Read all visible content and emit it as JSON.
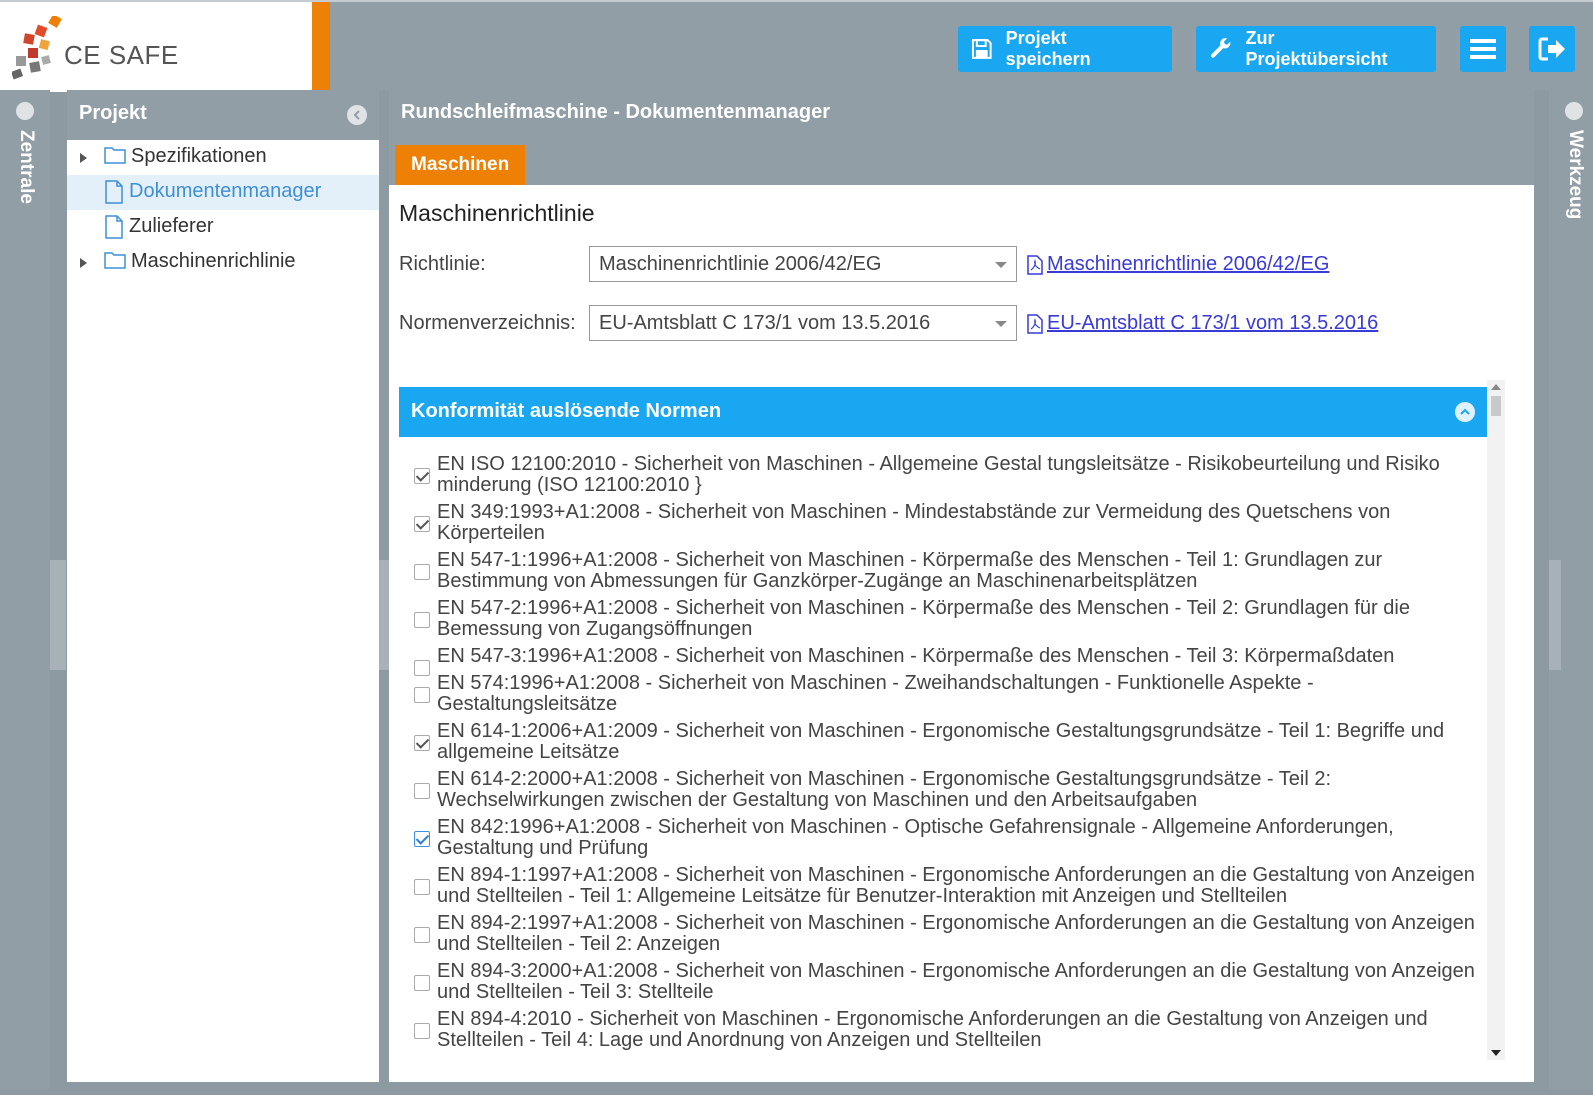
{
  "header": {
    "logo_text": "CE SAFE",
    "save_label": "Projekt speichern",
    "overview_label": "Zur Projektübersicht"
  },
  "rails": {
    "left_label": "Zentrale",
    "right_label": "Werkzeug"
  },
  "project_panel": {
    "title": "Projekt",
    "tree": [
      {
        "label": "Spezifikationen",
        "type": "folder",
        "expandable": true
      },
      {
        "label": "Dokumentenmanager",
        "type": "file",
        "selected": true
      },
      {
        "label": "Zulieferer",
        "type": "file"
      },
      {
        "label": "Maschinenrichlinie",
        "type": "folder",
        "expandable": true
      }
    ]
  },
  "main": {
    "title": "Rundschleifmaschine - Dokumentenmanager",
    "tab": "Maschinen",
    "section_title": "Maschinenrichtlinie",
    "richtlinie_label": "Richtlinie:",
    "richtlinie_value": "Maschinenrichtlinie 2006/42/EG",
    "richtlinie_link": "Maschinenrichtlinie 2006/42/EG",
    "normen_label": "Normenverzeichnis:",
    "normen_value": "EU-Amtsblatt C 173/1 vom 13.5.2016",
    "normen_link": "EU-Amtsblatt C 173/1 vom 13.5.2016",
    "accordion_title": "Konformität auslösende Normen"
  },
  "norms": [
    {
      "text": "EN ISO 12100:2010 - Sicherheit von Maschinen - Allgemeine Gestal tungsleitsätze - Risikobeurteilung und Risiko minderung (ISO 12100:2010 }",
      "checked": true
    },
    {
      "text": "EN 349:1993+A1:2008 - Sicherheit von Maschinen - Mindestabstände zur Vermeidung des Quetschens von Körperteilen",
      "checked": true
    },
    {
      "text": "EN 547-1:1996+A1:2008 - Sicherheit von Maschinen - Körpermaße des Menschen - Teil 1: Grundlagen zur Bestimmung von Abmessungen für Ganzkörper-Zugänge an Maschinenarbeitsplätzen",
      "checked": false
    },
    {
      "text": "EN 547-2:1996+A1:2008 - Sicherheit von Maschinen - Körpermaße des Menschen - Teil 2: Grundlagen für die Bemessung von Zugangsöffnungen",
      "checked": false
    },
    {
      "text": "EN 547-3:1996+A1:2008 - Sicherheit von Maschinen - Körpermaße des Menschen - Teil 3: Körpermaßdaten",
      "checked": false
    },
    {
      "text": "EN 574:1996+A1:2008 - Sicherheit von Maschinen - Zweihandschaltungen - Funktionelle Aspekte - Gestaltungsleitsätze",
      "checked": false
    },
    {
      "text": "EN 614-1:2006+A1:2009 - Sicherheit von Maschinen - Ergonomische Gestaltungsgrundsätze - Teil 1: Begriffe und allgemeine Leitsätze",
      "checked": true
    },
    {
      "text": "EN 614-2:2000+A1:2008 - Sicherheit von Maschinen - Ergonomische Gestaltungsgrundsätze - Teil 2: Wechselwirkungen zwischen der Gestaltung von Maschinen und den Arbeitsaufgaben",
      "checked": false
    },
    {
      "text": "EN 842:1996+A1:2008 - Sicherheit von Maschinen - Optische Gefahrensignale - Allgemeine Anforderungen, Gestaltung und Prüfung",
      "checked": true,
      "highlight": true
    },
    {
      "text": "EN 894-1:1997+A1:2008 - Sicherheit von Maschinen - Ergonomische Anforderungen an die Gestaltung von Anzeigen und Stellteilen - Teil 1: Allgemeine Leitsätze für Benutzer-Interaktion mit Anzeigen und Stellteilen",
      "checked": false
    },
    {
      "text": "EN 894-2:1997+A1:2008 - Sicherheit von Maschinen - Ergonomische Anforderungen an die Gestaltung von Anzeigen und Stellteilen - Teil 2: Anzeigen",
      "checked": false
    },
    {
      "text": "EN 894-3:2000+A1:2008 - Sicherheit von Maschinen - Ergonomische Anforderungen an die Gestaltung von Anzeigen und Stellteilen - Teil 3: Stellteile",
      "checked": false
    },
    {
      "text": "EN 894-4:2010 - Sicherheit von Maschinen - Ergonomische Anforderungen an die Gestaltung von Anzeigen und Stellteilen - Teil 4: Lage und Anordnung von Anzeigen und Stellteilen",
      "checked": false
    }
  ],
  "colors": {
    "accent_blue": "#1aa7f2",
    "accent_orange": "#ee8105",
    "chrome_gray": "#929ea6"
  }
}
